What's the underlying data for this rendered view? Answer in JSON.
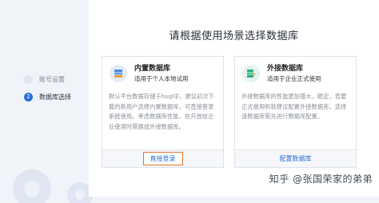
{
  "title": "请根据使用场景选择数据库",
  "steps": [
    {
      "number": "",
      "label": "账号设置"
    },
    {
      "number": "2",
      "label": "数据库选择"
    }
  ],
  "cards": {
    "internal": {
      "icon": "database-icon",
      "title": "内置数据库",
      "subtitle": "适用于个人本地试用",
      "description": "默认平台数据存储于hsql中，建议初次下载的新用户选择内置数据库，可直接登录系统使用。考虑数据库性能，在开放给企业使用时需换成外接数据库。",
      "button": "直接登录"
    },
    "external": {
      "icon": "database-plus-icon",
      "title": "外接数据库",
      "subtitle": "适用于企业正式使用",
      "description": "外接数据库的性能更加强大，稳定，若要正式使用帆软建议配置外接数据库。选择该数据库需先进行数据库配置。",
      "button": "配置数据库"
    }
  },
  "watermark": "知乎 @张国荣家的弟弟",
  "colors": {
    "accent": "#2b6fd6",
    "highlight_border": "#e8742c",
    "green": "#2fae7f"
  }
}
